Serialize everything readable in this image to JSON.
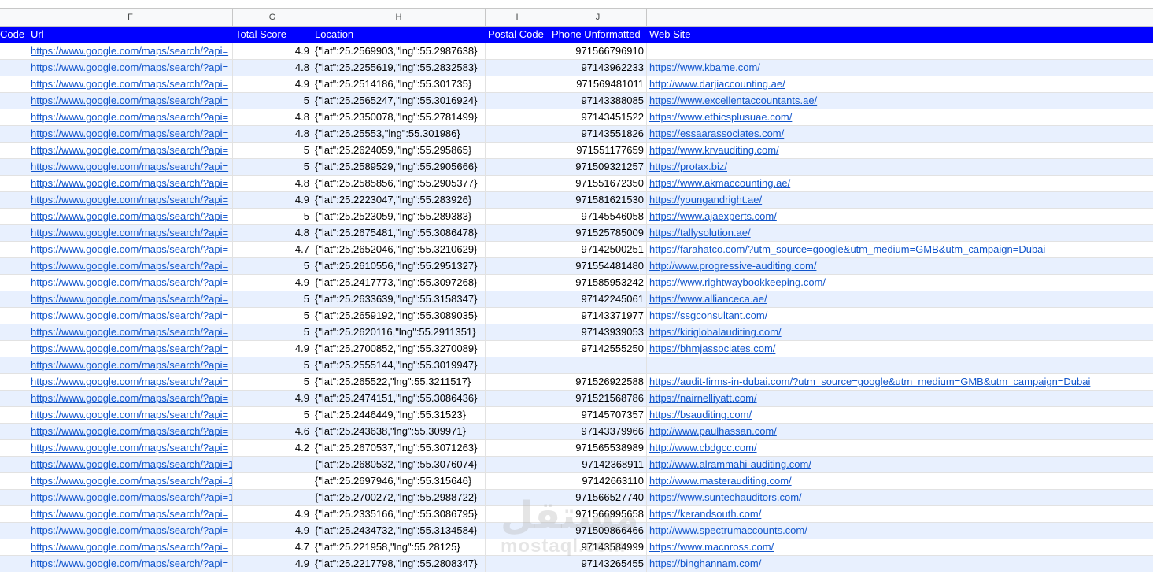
{
  "column_letters": [
    "F",
    "G",
    "H",
    "I",
    "J"
  ],
  "headers": {
    "code": "Code",
    "url": "Url",
    "total_score": "Total Score",
    "location": "Location",
    "postal_code": "Postal Code",
    "phone": "Phone Unformatted",
    "web_site": "Web Site"
  },
  "rows": [
    {
      "url": "https://www.google.com/maps/search/?api=",
      "score": "4.9",
      "loc": "{\"lat\":25.2569903,\"lng\":55.2987638}",
      "phone": "971566796910",
      "web": ""
    },
    {
      "url": "https://www.google.com/maps/search/?api=",
      "score": "4.8",
      "loc": "{\"lat\":25.2255619,\"lng\":55.2832583}",
      "phone": "97143962233",
      "web": "https://www.kbame.com/"
    },
    {
      "url": "https://www.google.com/maps/search/?api=",
      "score": "4.9",
      "loc": "{\"lat\":25.2514186,\"lng\":55.301735}",
      "phone": "971569481011",
      "web": "http://www.darjiaccounting.ae/"
    },
    {
      "url": "https://www.google.com/maps/search/?api=",
      "score": "5",
      "loc": "{\"lat\":25.2565247,\"lng\":55.3016924}",
      "phone": "97143388085",
      "web": "https://www.excellentaccountants.ae/"
    },
    {
      "url": "https://www.google.com/maps/search/?api=",
      "score": "4.8",
      "loc": "{\"lat\":25.2350078,\"lng\":55.2781499}",
      "phone": "97143451522",
      "web": "https://www.ethicsplusuae.com/"
    },
    {
      "url": "https://www.google.com/maps/search/?api=",
      "score": "4.8",
      "loc": "{\"lat\":25.25553,\"lng\":55.301986}",
      "phone": "97143551826",
      "web": "https://essaarassociates.com/"
    },
    {
      "url": "https://www.google.com/maps/search/?api=",
      "score": "5",
      "loc": "{\"lat\":25.2624059,\"lng\":55.295865}",
      "phone": "971551177659",
      "web": "https://www.krvauditing.com/"
    },
    {
      "url": "https://www.google.com/maps/search/?api=",
      "score": "5",
      "loc": "{\"lat\":25.2589529,\"lng\":55.2905666}",
      "phone": "971509321257",
      "web": "https://protax.biz/"
    },
    {
      "url": "https://www.google.com/maps/search/?api=",
      "score": "4.8",
      "loc": "{\"lat\":25.2585856,\"lng\":55.2905377}",
      "phone": "971551672350",
      "web": "https://www.akmaccounting.ae/"
    },
    {
      "url": "https://www.google.com/maps/search/?api=",
      "score": "4.9",
      "loc": "{\"lat\":25.2223047,\"lng\":55.283926}",
      "phone": "971581621530",
      "web": "https://youngandright.ae/"
    },
    {
      "url": "https://www.google.com/maps/search/?api=",
      "score": "5",
      "loc": "{\"lat\":25.2523059,\"lng\":55.289383}",
      "phone": "97145546058",
      "web": "https://www.ajaexperts.com/"
    },
    {
      "url": "https://www.google.com/maps/search/?api=",
      "score": "4.8",
      "loc": "{\"lat\":25.2675481,\"lng\":55.3086478}",
      "phone": "971525785009",
      "web": "https://tallysolution.ae/"
    },
    {
      "url": "https://www.google.com/maps/search/?api=",
      "score": "4.7",
      "loc": "{\"lat\":25.2652046,\"lng\":55.3210629}",
      "phone": "97142500251",
      "web": "https://farahatco.com/?utm_source=google&utm_medium=GMB&utm_campaign=Dubai"
    },
    {
      "url": "https://www.google.com/maps/search/?api=",
      "score": "5",
      "loc": "{\"lat\":25.2610556,\"lng\":55.2951327}",
      "phone": "971554481480",
      "web": "http://www.progressive-auditing.com/"
    },
    {
      "url": "https://www.google.com/maps/search/?api=",
      "score": "4.9",
      "loc": "{\"lat\":25.2417773,\"lng\":55.3097268}",
      "phone": "971585953242",
      "web": "https://www.rightwaybookkeeping.com/"
    },
    {
      "url": "https://www.google.com/maps/search/?api=",
      "score": "5",
      "loc": "{\"lat\":25.2633639,\"lng\":55.3158347}",
      "phone": "97142245061",
      "web": "https://www.allianceca.ae/"
    },
    {
      "url": "https://www.google.com/maps/search/?api=",
      "score": "5",
      "loc": "{\"lat\":25.2659192,\"lng\":55.3089035}",
      "phone": "97143371977",
      "web": "https://ssgconsultant.com/"
    },
    {
      "url": "https://www.google.com/maps/search/?api=",
      "score": "5",
      "loc": "{\"lat\":25.2620116,\"lng\":55.2911351}",
      "phone": "97143939053",
      "web": "https://kiriglobalauditing.com/"
    },
    {
      "url": "https://www.google.com/maps/search/?api=",
      "score": "4.9",
      "loc": "{\"lat\":25.2700852,\"lng\":55.3270089}",
      "phone": "97142555250",
      "web": "https://bhmjassociates.com/"
    },
    {
      "url": "https://www.google.com/maps/search/?api=",
      "score": "5",
      "loc": "{\"lat\":25.2555144,\"lng\":55.3019947}",
      "phone": "",
      "web": ""
    },
    {
      "url": "https://www.google.com/maps/search/?api=",
      "score": "5",
      "loc": "{\"lat\":25.265522,\"lng\":55.3211517}",
      "phone": "971526922588",
      "web": "https://audit-firms-in-dubai.com/?utm_source=google&utm_medium=GMB&utm_campaign=Dubai"
    },
    {
      "url": "https://www.google.com/maps/search/?api=",
      "score": "4.9",
      "loc": "{\"lat\":25.2474151,\"lng\":55.3086436}",
      "phone": "971521568786",
      "web": "https://nairnelliyatt.com/"
    },
    {
      "url": "https://www.google.com/maps/search/?api=",
      "score": "5",
      "loc": "{\"lat\":25.2446449,\"lng\":55.31523}",
      "phone": "97145707357",
      "web": "https://bsauditing.com/"
    },
    {
      "url": "https://www.google.com/maps/search/?api=",
      "score": "4.6",
      "loc": "{\"lat\":25.243638,\"lng\":55.309971}",
      "phone": "97143379966",
      "web": "http://www.paulhassan.com/"
    },
    {
      "url": "https://www.google.com/maps/search/?api=",
      "score": "4.2",
      "loc": "{\"lat\":25.2670537,\"lng\":55.3071263}",
      "phone": "971565538989",
      "web": "http://www.cbdgcc.com/"
    },
    {
      "url": "https://www.google.com/maps/search/?api=1&query=Alramm",
      "score": "",
      "loc": "{\"lat\":25.2680532,\"lng\":55.3076074}",
      "phone": "97142368911",
      "web": "http://www.alrammahi-auditing.com/"
    },
    {
      "url": "https://www.google.com/maps/search/?api=1&query=Master",
      "score": "",
      "loc": "{\"lat\":25.2697946,\"lng\":55.315646}",
      "phone": "97142663110",
      "web": "http://www.masterauditing.com/"
    },
    {
      "url": "https://www.google.com/maps/search/?api=1&query=Suntec",
      "score": "",
      "loc": "{\"lat\":25.2700272,\"lng\":55.2988722}",
      "phone": "971566527740",
      "web": "https://www.suntechauditors.com/"
    },
    {
      "url": "https://www.google.com/maps/search/?api=",
      "score": "4.9",
      "loc": "{\"lat\":25.2335166,\"lng\":55.3086795}",
      "phone": "971566995658",
      "web": "https://kerandsouth.com/"
    },
    {
      "url": "https://www.google.com/maps/search/?api=",
      "score": "4.9",
      "loc": "{\"lat\":25.2434732,\"lng\":55.3134584}",
      "phone": "971509866466",
      "web": "http://www.spectrumaccounts.com/"
    },
    {
      "url": "https://www.google.com/maps/search/?api=",
      "score": "4.7",
      "loc": "{\"lat\":25.221958,\"lng\":55.28125}",
      "phone": "97143584999",
      "web": "https://www.macnross.com/"
    },
    {
      "url": "https://www.google.com/maps/search/?api=",
      "score": "4.9",
      "loc": "{\"lat\":25.2217798,\"lng\":55.2808347}",
      "phone": "97143265455",
      "web": "https://binghannam.com/"
    }
  ],
  "watermark": {
    "arabic": "مستقل",
    "latin": "mostaql.com"
  }
}
